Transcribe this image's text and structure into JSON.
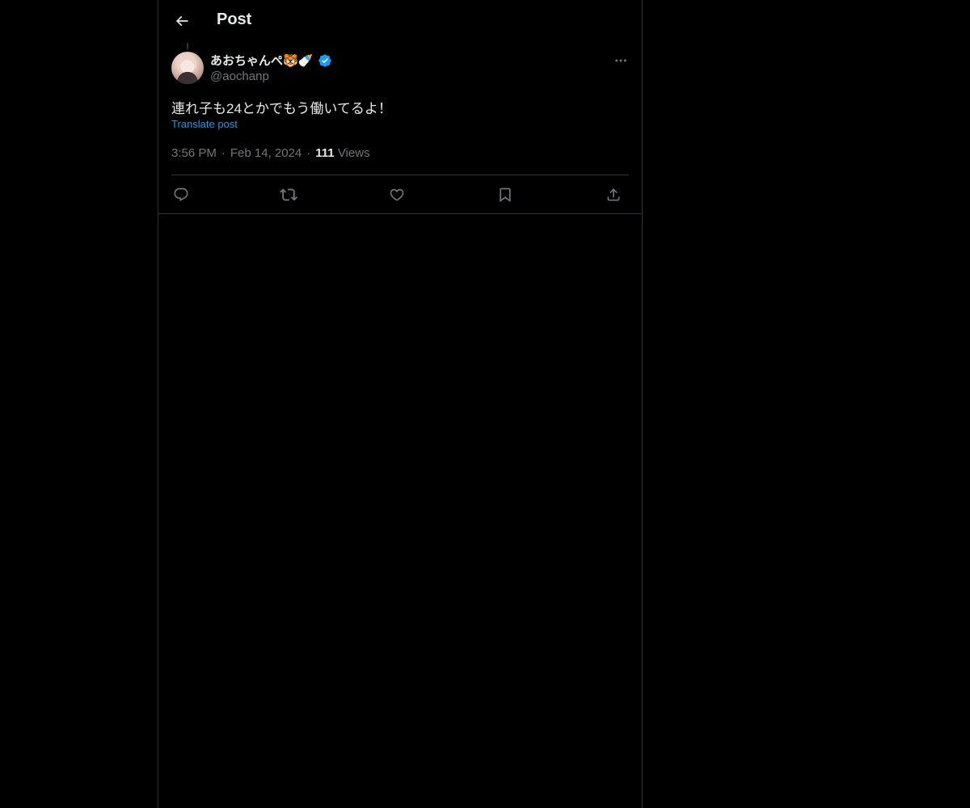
{
  "header": {
    "back_icon": "arrow-left-icon",
    "title": "Post"
  },
  "post": {
    "author": {
      "display_name": "あおちゃんぺ🐯🍼",
      "verified_icon": "verified-badge-icon",
      "handle": "@aochanp"
    },
    "more_icon": "more-horizontal-icon",
    "text": "連れ子も24とかでもう働いてるよ！",
    "translate_label": "Translate post",
    "time": "3:56 PM",
    "date": "Feb 14, 2024",
    "separator": "·",
    "views_count": "111",
    "views_label": "Views"
  },
  "actions": [
    {
      "name": "reply",
      "icon": "reply-icon"
    },
    {
      "name": "repost",
      "icon": "repost-icon"
    },
    {
      "name": "like",
      "icon": "heart-icon"
    },
    {
      "name": "bookmark",
      "icon": "bookmark-icon"
    },
    {
      "name": "share",
      "icon": "share-icon"
    }
  ],
  "colors": {
    "background": "#000000",
    "text": "#e7e9ea",
    "secondary_text": "#71767b",
    "accent": "#1d9bf0",
    "border": "#2f3336"
  }
}
